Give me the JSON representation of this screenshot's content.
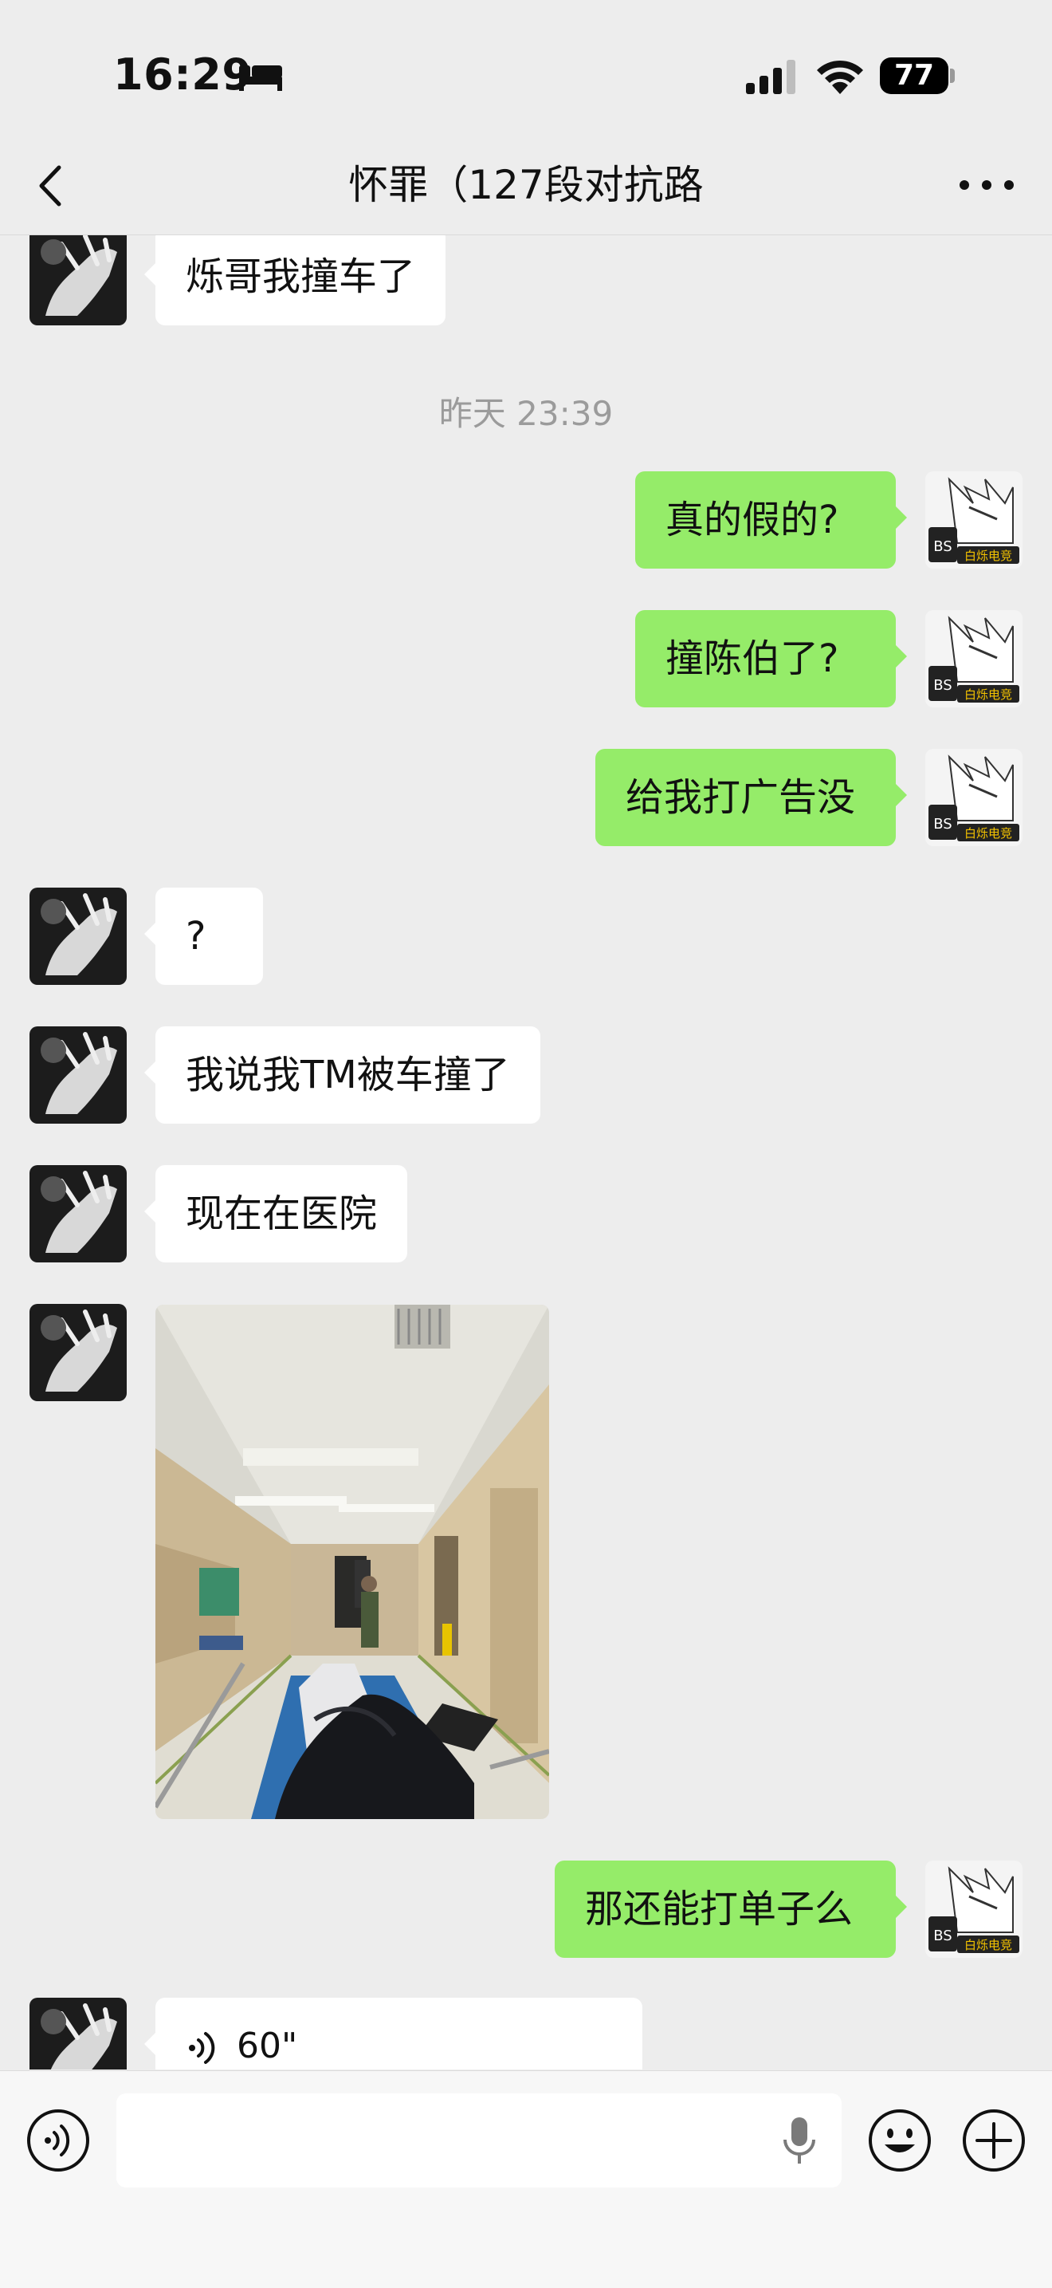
{
  "status_bar": {
    "time": "16:29",
    "battery": "77"
  },
  "nav": {
    "title": "怀罪（127段对抗路"
  },
  "chat": {
    "messages": [
      {
        "side": "left",
        "type": "text",
        "text": "烁哥我撞车了"
      },
      {
        "type": "timestamp",
        "text": "昨天 23:39"
      },
      {
        "side": "right",
        "type": "text",
        "text": "真的假的?"
      },
      {
        "side": "right",
        "type": "text",
        "text": "撞陈伯了?"
      },
      {
        "side": "right",
        "type": "text",
        "text": "给我打广告没"
      },
      {
        "side": "left",
        "type": "text",
        "text": "?"
      },
      {
        "side": "left",
        "type": "text",
        "text": "我说我TM被车撞了"
      },
      {
        "side": "left",
        "type": "text",
        "text": "现在在医院"
      },
      {
        "side": "left",
        "type": "image",
        "description_icon": "hospital-photo"
      },
      {
        "side": "right",
        "type": "text",
        "text": "那还能打单子么"
      },
      {
        "side": "left",
        "type": "voice",
        "duration": "60\""
      }
    ],
    "self_avatar_badge": "白烁电竞"
  },
  "colors": {
    "background": "#EDEDED",
    "bubble_self": "#95EC69",
    "bubble_other": "#FFFFFF",
    "timestamp": "#9B9B9B"
  },
  "icons": {
    "back": "chevron-left-icon",
    "more": "more-dots-icon",
    "voice_toggle": "voice-toggle-icon",
    "mic": "microphone-icon",
    "emoji": "emoji-icon",
    "plus": "plus-icon"
  }
}
